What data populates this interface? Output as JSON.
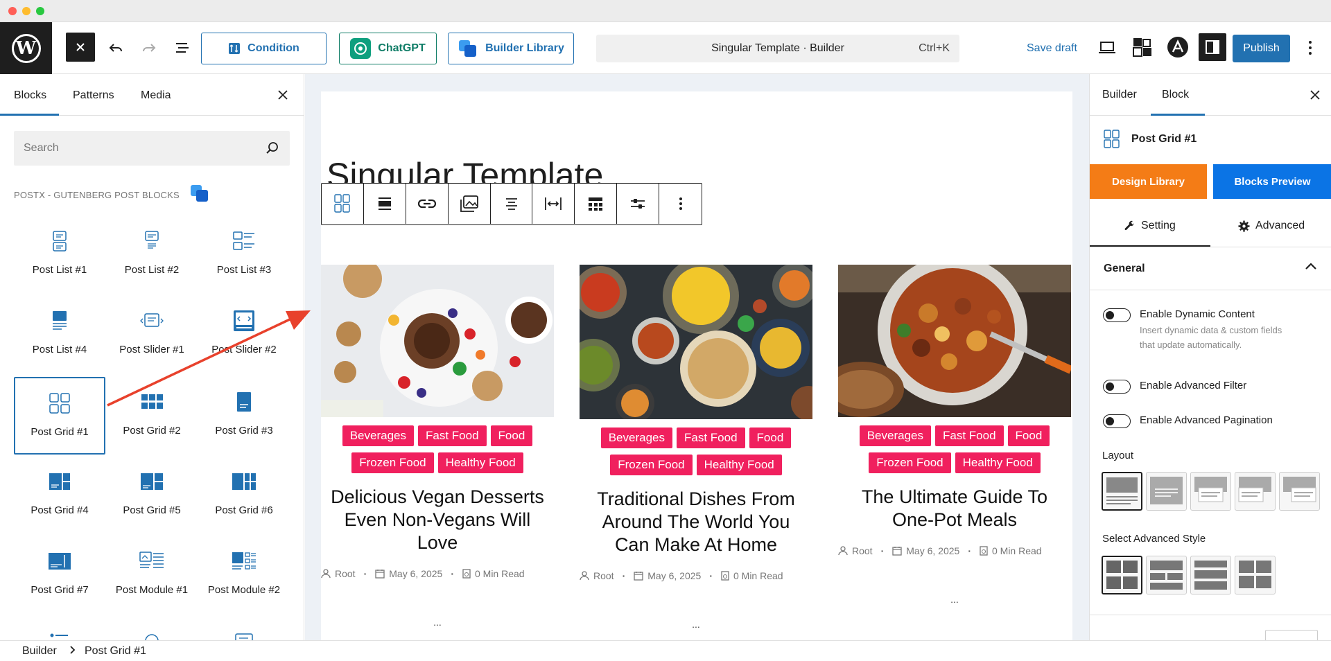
{
  "window": {
    "controls": [
      "close",
      "minimize",
      "maximize"
    ],
    "colors": {
      "close": "#ff5f57",
      "minimize": "#febc2e",
      "maximize": "#28c840"
    }
  },
  "topbar": {
    "condition_label": "Condition",
    "chatgpt_label": "ChatGPT",
    "library_label": "Builder Library",
    "command_title": "Singular Template · Builder",
    "command_shortcut": "Ctrl+K",
    "save_draft": "Save draft",
    "publish": "Publish",
    "icons": [
      "wordpress-logo",
      "close-icon",
      "undo-icon",
      "redo-icon",
      "list-view-icon",
      "laptop-preview-icon",
      "style-book-icon",
      "astra-icon",
      "settings-sidebar-icon",
      "more-options-icon"
    ]
  },
  "inserter": {
    "tabs": [
      "Blocks",
      "Patterns",
      "Media"
    ],
    "active_tab": "Blocks",
    "search_placeholder": "Search",
    "category": "POSTX - GUTENBERG POST BLOCKS",
    "blocks": [
      {
        "label": "Post List #1",
        "icon": "post-list-1-icon"
      },
      {
        "label": "Post List #2",
        "icon": "post-list-2-icon"
      },
      {
        "label": "Post List #3",
        "icon": "post-list-3-icon"
      },
      {
        "label": "Post List #4",
        "icon": "post-list-4-icon"
      },
      {
        "label": "Post Slider #1",
        "icon": "post-slider-1-icon"
      },
      {
        "label": "Post Slider #2",
        "icon": "post-slider-2-icon"
      },
      {
        "label": "Post Grid #1",
        "icon": "post-grid-1-icon",
        "selected": true
      },
      {
        "label": "Post Grid #2",
        "icon": "post-grid-2-icon"
      },
      {
        "label": "Post Grid #3",
        "icon": "post-grid-3-icon"
      },
      {
        "label": "Post Grid #4",
        "icon": "post-grid-4-icon"
      },
      {
        "label": "Post Grid #5",
        "icon": "post-grid-5-icon"
      },
      {
        "label": "Post Grid #6",
        "icon": "post-grid-6-icon"
      },
      {
        "label": "Post Grid #7",
        "icon": "post-grid-7-icon"
      },
      {
        "label": "Post Module #1",
        "icon": "post-module-1-icon"
      },
      {
        "label": "Post Module #2",
        "icon": "post-module-2-icon"
      }
    ]
  },
  "canvas": {
    "page_title": "Singular Template",
    "block_toolbar_icons": [
      "post-grid-block-icon",
      "align-icon",
      "link-icon",
      "image-gallery-icon",
      "text-align-icon",
      "width-icon",
      "table-layout-icon",
      "settings-sliders-icon",
      "more-vertical-icon"
    ],
    "posts": [
      {
        "image": "vegan-desserts-image",
        "tags": [
          "Beverages",
          "Fast Food",
          "Food",
          "Frozen Food",
          "Healthy Food"
        ],
        "title": "Delicious Vegan Desserts Even Non-Vegans Will Love",
        "author": "Root",
        "date": "May 6, 2025",
        "read": "0 Min Read",
        "more": "..."
      },
      {
        "image": "traditional-dishes-image",
        "tags": [
          "Beverages",
          "Fast Food",
          "Food",
          "Frozen Food",
          "Healthy Food"
        ],
        "title": "Traditional Dishes From Around The World You Can Make At Home",
        "author": "Root",
        "date": "May 6, 2025",
        "read": "0 Min Read",
        "more": "..."
      },
      {
        "image": "one-pot-meal-image",
        "tags": [
          "Beverages",
          "Fast Food",
          "Food",
          "Frozen Food",
          "Healthy Food"
        ],
        "title": "The Ultimate Guide To One-Pot Meals",
        "author": "Root",
        "date": "May 6, 2025",
        "read": "0 Min Read",
        "more": "..."
      }
    ],
    "tag_color": "#f0205e"
  },
  "settings": {
    "tabs": [
      "Builder",
      "Block"
    ],
    "active_tab": "Block",
    "block_name": "Post Grid #1",
    "design_library": "Design Library",
    "blocks_preview": "Blocks Preview",
    "design_library_color": "#f47c16",
    "blocks_preview_color": "#0b74e5",
    "sub_tabs": [
      "Setting",
      "Advanced"
    ],
    "active_sub_tab": "Setting",
    "section": "General",
    "toggles": [
      {
        "label": "Enable Dynamic Content",
        "help": "Insert dynamic data & custom fields that update automatically.",
        "on": false
      },
      {
        "label": "Enable Advanced Filter",
        "help": "",
        "on": false
      },
      {
        "label": "Enable Advanced Pagination",
        "help": "",
        "on": false
      }
    ],
    "layout_label": "Layout",
    "layout_options_count": 5,
    "layout_selected_index": 0,
    "advanced_style_label": "Select Advanced Style",
    "advanced_style_count": 4,
    "advanced_style_selected_index": 0
  },
  "breadcrumb": {
    "root": "Builder",
    "current": "Post Grid #1"
  }
}
